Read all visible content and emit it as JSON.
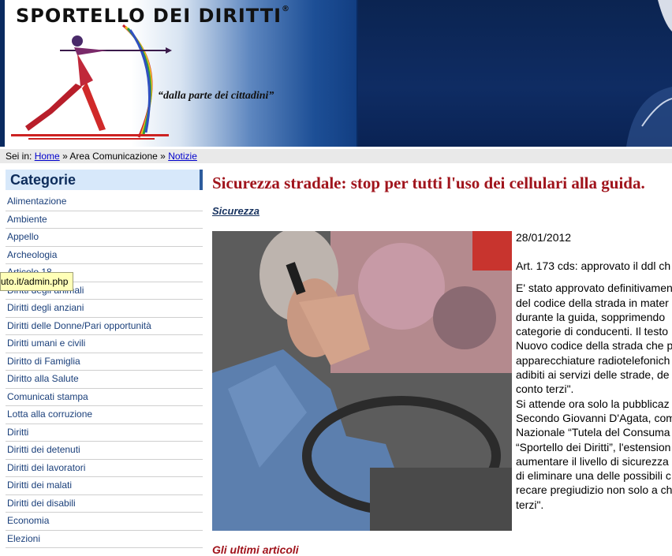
{
  "header": {
    "brand_name": "SPORTELLO DEI DIRITTI",
    "registered_mark": "®",
    "tagline": "“dalla parte dei cittadini”"
  },
  "breadcrumb": {
    "prefix": "Sei in:",
    "home": "Home",
    "separator": "»",
    "section": "Area Comunicazione",
    "current": "Notizie"
  },
  "sidebar": {
    "heading": "Categorie",
    "items": [
      "Alimentazione",
      "Ambiente",
      "Appello",
      "Archeologia",
      "Articolo 18",
      "Diritti degli animali",
      "Diritti degli anziani",
      "Diritti delle Donne/Pari opportunità",
      "Diritti umani e civili",
      "Diritto di Famiglia",
      "Diritto alla Salute",
      "Comunicati stampa",
      "Lotta alla corruzione",
      "Diritti",
      "Diritti dei detenuti",
      "Diritti dei lavoratori",
      "Diritti dei malati",
      "Diritti dei disabili",
      "Economia",
      "Elezioni"
    ]
  },
  "tooltip": "uto.it/admin.php",
  "article": {
    "title": "Sicurezza stradale: stop per tutti l'uso dei cellulari alla guida.",
    "section": "Sicurezza",
    "date": "28/01/2012",
    "subtitle": "Art. 173 cds: approvato il ddl ch",
    "body_lines": [
      "E' stato approvato definitivamen",
      "del codice della strada in mater",
      "durante la guida, sopprimendo",
      "categorie di conducenti. Il testo",
      "Nuovo codice della strada che p",
      "apparecchiature radiotelefonich",
      "adibiti ai servizi delle strade, de",
      "conto terzi\".",
      "Si attende ora solo la pubblicaz",
      "Secondo Giovanni D'Agata, com",
      "Nazionale “Tutela del Consuma",
      "“Sportello dei Diritti”, l'estension",
      "aumentare il livello di sicurezza",
      "di eliminare una delle possibili c",
      "recare pregiudizio non solo a ch",
      "terzi\"."
    ],
    "bottom_heading": "Gli ultimi articoli"
  }
}
